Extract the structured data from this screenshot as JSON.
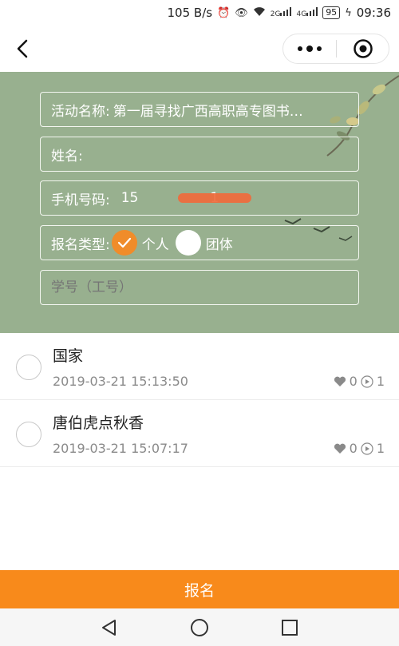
{
  "status_bar": {
    "network_speed": "105 B/s",
    "signal_2g": "2G",
    "signal_4g": "4G",
    "battery": "95",
    "time": "09:36"
  },
  "form": {
    "activity_label": "活动名称:",
    "activity_value": "第一届寻找广西高职高专图书…",
    "name_label": "姓名:",
    "name_value": "",
    "phone_label": "手机号码:",
    "phone_value_start": "15",
    "phone_value_end": "1",
    "type_label": "报名类型:",
    "type_option_personal": "个人",
    "type_option_group": "团体",
    "student_id_placeholder": "学号（工号）"
  },
  "list": [
    {
      "name": "国家",
      "time": "2019-03-21 15:13:50",
      "likes": "0",
      "plays": "1"
    },
    {
      "name": "唐伯虎点秋香",
      "time": "2019-03-21 15:07:17",
      "likes": "0",
      "plays": "1"
    }
  ],
  "submit_label": "报名",
  "colors": {
    "hero_bg": "#98b08f",
    "accent": "#f88a1b"
  }
}
